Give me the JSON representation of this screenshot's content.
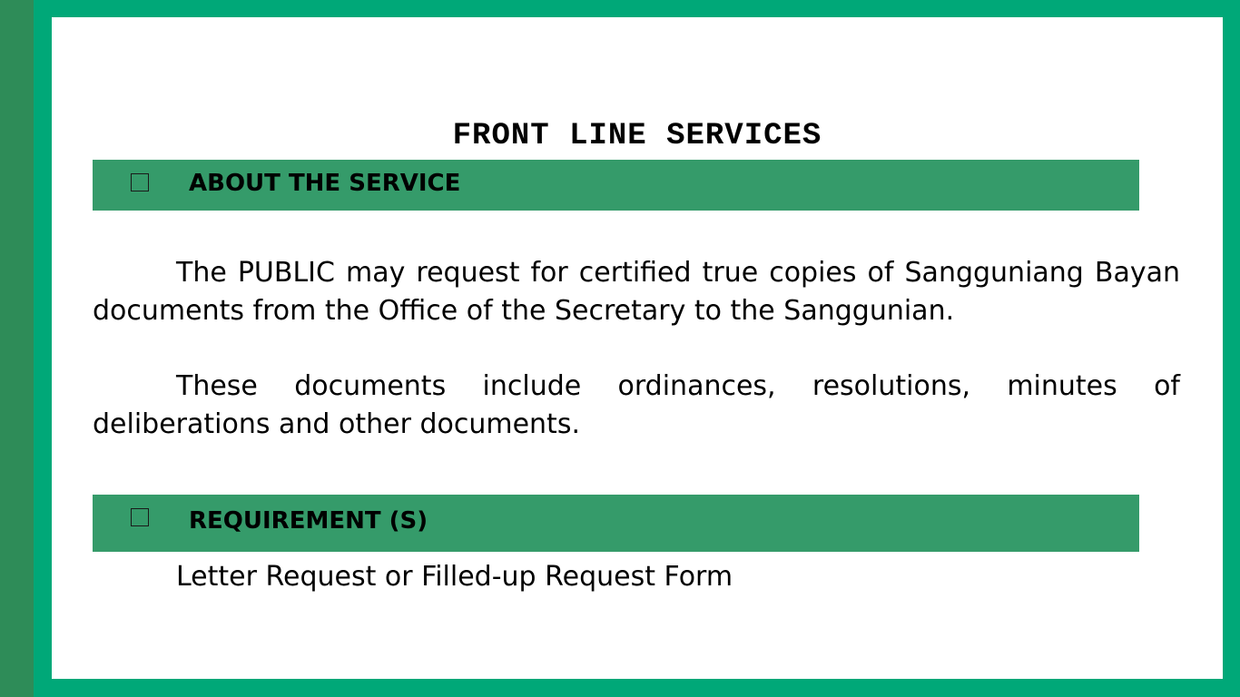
{
  "slide": {
    "title": "FRONT LINE SERVICES"
  },
  "about_section": {
    "label": "ABOUT THE SERVICE",
    "paragraphs": [
      "The PUBLIC may request for certified true copies of Sangguniang Bayan documents from the Office of the Secretary to the Sanggunian.",
      "These documents include ordinances, resolutions, minutes of deliberations and other documents."
    ]
  },
  "requirement_section": {
    "label": "REQUIREMENT (S)",
    "items": [
      "Letter Request or Filled-up Request Form"
    ]
  },
  "colors": {
    "frame": "#00a878",
    "left_strip": "#2e8c58",
    "section_bar": "#359b6a",
    "slide_background": "#ffffff"
  }
}
